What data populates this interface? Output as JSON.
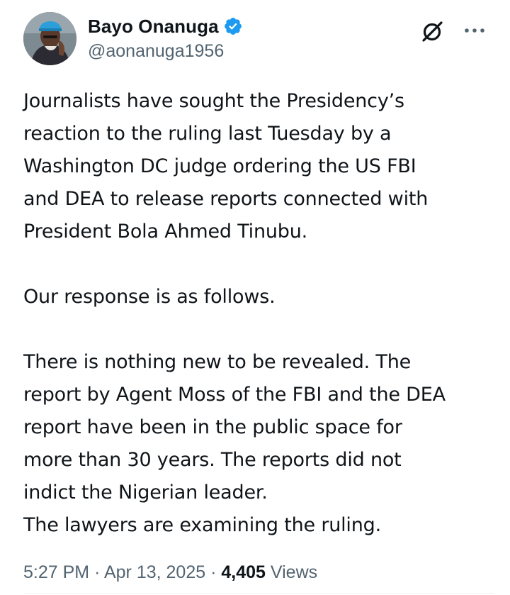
{
  "author": {
    "display_name": "Bayo Onanuga",
    "handle": "@aonanuga1956",
    "verified": true,
    "verified_color": "#1d9bf0"
  },
  "header_icons": {
    "grok": "grok-icon",
    "more": "more-icon"
  },
  "tweet": {
    "lines_block1": [
      "Journalists have sought the Presidency’s",
      "reaction to the ruling last Tuesday by a",
      "Washington DC judge ordering the US FBI",
      "and DEA to release reports connected with",
      "President Bola Ahmed Tinubu."
    ],
    "line_block2": "Our response is as follows.",
    "lines_block3": [
      "There is nothing new to be revealed. The",
      "report by Agent Moss of the FBI and the DEA",
      "report have been in the public space for",
      "more than 30 years. The reports did not",
      "indict the Nigerian leader.",
      "The lawyers are examining the ruling."
    ]
  },
  "meta": {
    "time": "5:27 PM",
    "separator": "·",
    "date": "Apr 13, 2025",
    "views_count": "4,405",
    "views_label": "Views"
  },
  "colors": {
    "text": "#0f1419",
    "secondary": "#536471",
    "accent": "#1d9bf0"
  }
}
